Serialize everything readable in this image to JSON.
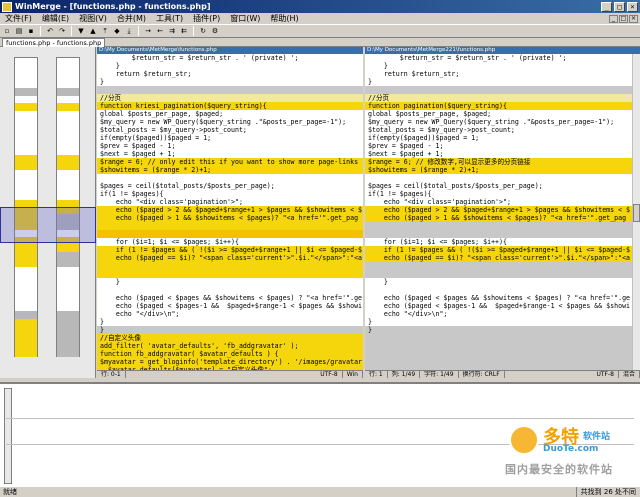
{
  "window": {
    "title": "WinMerge - [functions.php - functions.php]"
  },
  "menu": [
    "文件(F)",
    "编辑(E)",
    "视图(V)",
    "合并(M)",
    "工具(T)",
    "插件(P)",
    "窗口(W)",
    "帮助(H)"
  ],
  "doc_tab": "functions.php - functions.php",
  "left": {
    "path": "D:\\My Documents\\MetMerge\\functions.php",
    "status": [
      "行: 0-1",
      "UTF-8",
      "Win"
    ],
    "lines": [
      {
        "t": "        $return_str = $return_str . ' (private) ';",
        "c": ""
      },
      {
        "t": "    }",
        "c": ""
      },
      {
        "t": "    return $return_str;",
        "c": ""
      },
      {
        "t": "}",
        "c": ""
      },
      {
        "t": "",
        "c": "blank"
      },
      {
        "t": "//分页",
        "c": "cur"
      },
      {
        "t": "function kriesi_pagination($query_string){",
        "c": "chg"
      },
      {
        "t": "global $posts_per_page, $paged;",
        "c": ""
      },
      {
        "t": "$my_query = new WP_Query($query_string .\"&posts_per_page=-1\");",
        "c": ""
      },
      {
        "t": "$total_posts = $my_query->post_count;",
        "c": ""
      },
      {
        "t": "if(empty($paged))$paged = 1;",
        "c": ""
      },
      {
        "t": "$prev = $paged - 1;",
        "c": ""
      },
      {
        "t": "$next = $paged + 1;",
        "c": ""
      },
      {
        "t": "$range = 6; // only edit this if you want to show more page-links",
        "c": "chg"
      },
      {
        "t": "$showitems = ($range * 2)+1;",
        "c": "chg"
      },
      {
        "t": "",
        "c": ""
      },
      {
        "t": "$pages = ceil($total_posts/$posts_per_page);",
        "c": ""
      },
      {
        "t": "if(1 != $pages){",
        "c": ""
      },
      {
        "t": "    echo \"<div class='pagination'>\";",
        "c": ""
      },
      {
        "t": "    echo ($paged > 2 && $paged+$range+1 > $pages && $showitems < $",
        "c": "chg"
      },
      {
        "t": "    echo ($paged > 1 && $showitems < $pages)? \"<a href='\".get_pag",
        "c": "chg"
      },
      {
        "t": "",
        "c": "chg"
      },
      {
        "t": "",
        "c": "sel"
      },
      {
        "t": "    for ($i=1; $i <= $pages; $i++){",
        "c": ""
      },
      {
        "t": "    if (1 != $pages && ( !($i >= $paged+$range+1 || $i <= $paged-$",
        "c": "chg"
      },
      {
        "t": "    echo ($paged == $i)? \"<span class='current'>\".$i.\"</span>\":\"<a",
        "c": "chg"
      },
      {
        "t": "",
        "c": "chg"
      },
      {
        "t": "",
        "c": "chg"
      },
      {
        "t": "    }",
        "c": ""
      },
      {
        "t": "",
        "c": ""
      },
      {
        "t": "    echo ($paged < $pages && $showitems < $pages) ? \"<a href='\".ge",
        "c": ""
      },
      {
        "t": "    echo ($paged < $pages-1 &&  $paged+$range-1 < $pages && $showi",
        "c": ""
      },
      {
        "t": "    echo \"</div>\\n\";",
        "c": ""
      },
      {
        "t": "}",
        "c": ""
      },
      {
        "t": "}",
        "c": "blank"
      },
      {
        "t": "//自定义头像",
        "c": "chg"
      },
      {
        "t": "add_filter( 'avatar_defaults', 'fb_addgravatar' );",
        "c": "chg"
      },
      {
        "t": "function fb_addgravatar( $avatar_defaults ) {",
        "c": "chg"
      },
      {
        "t": "$myavatar = get_bloginfo('template_directory') . '/images/gravatar",
        "c": "chg"
      },
      {
        "t": "  $avatar_defaults[$myavatar] = \"自定义头像\";",
        "c": "chg"
      }
    ]
  },
  "right": {
    "path": "D:\\My Documents\\MetMerge221\\functions.php",
    "status": [
      "行: 1",
      "列: 1/49",
      "字符: 1/49",
      "换行符: CRLF",
      "UTF-8",
      "混合"
    ],
    "lines": [
      {
        "t": "        $return_str = $return_str . ' (private) ';",
        "c": ""
      },
      {
        "t": "    }",
        "c": ""
      },
      {
        "t": "    return $return_str;",
        "c": ""
      },
      {
        "t": "}",
        "c": ""
      },
      {
        "t": "",
        "c": "blank"
      },
      {
        "t": "//分页",
        "c": "cur"
      },
      {
        "t": "function pagination($query_string){",
        "c": "chg"
      },
      {
        "t": "global $posts_per_page, $paged;",
        "c": ""
      },
      {
        "t": "$my_query = new WP_Query($query_string .\"&posts_per_page=-1\");",
        "c": ""
      },
      {
        "t": "$total_posts = $my_query->post_count;",
        "c": ""
      },
      {
        "t": "if(empty($paged))$paged = 1;",
        "c": ""
      },
      {
        "t": "$prev = $paged - 1;",
        "c": ""
      },
      {
        "t": "$next = $paged + 1;",
        "c": ""
      },
      {
        "t": "$range = 6; // 修改数字,可以显示更多的分页链接",
        "c": "chg"
      },
      {
        "t": "$showitems = ($range * 2)+1;",
        "c": "chg"
      },
      {
        "t": "",
        "c": ""
      },
      {
        "t": "$pages = ceil($total_posts/$posts_per_page);",
        "c": ""
      },
      {
        "t": "if(1 != $pages){",
        "c": ""
      },
      {
        "t": "    echo \"<div class='pagination'>\";",
        "c": ""
      },
      {
        "t": "    echo ($paged > 2 && $paged+$range+1 > $pages && $showitems < $",
        "c": "chg"
      },
      {
        "t": "    echo ($paged > 1 && $showitems < $pages)? \"<a href='\".get_pag",
        "c": "chg"
      },
      {
        "t": "",
        "c": "blank"
      },
      {
        "t": "",
        "c": "blank"
      },
      {
        "t": "    for ($i=1; $i <= $pages; $i++){",
        "c": ""
      },
      {
        "t": "    if (1 != $pages && ( !($i >= $paged+$range+1 || $i <= $paged-$",
        "c": "chg"
      },
      {
        "t": "    echo ($paged == $i)? \"<span class='current'>\".$i.\"</span>\":\"<a",
        "c": "chg"
      },
      {
        "t": "",
        "c": "blank"
      },
      {
        "t": "",
        "c": "blank"
      },
      {
        "t": "    }",
        "c": ""
      },
      {
        "t": "",
        "c": ""
      },
      {
        "t": "    echo ($paged < $pages && $showitems < $pages) ? \"<a href='\".ge",
        "c": ""
      },
      {
        "t": "    echo ($paged < $pages-1 &&  $paged+$range-1 < $pages && $showi",
        "c": ""
      },
      {
        "t": "    echo \"</div>\\n\";",
        "c": ""
      },
      {
        "t": "}",
        "c": ""
      },
      {
        "t": "}",
        "c": "blank"
      },
      {
        "t": "",
        "c": "blank"
      },
      {
        "t": "",
        "c": "blank"
      },
      {
        "t": "",
        "c": "blank"
      },
      {
        "t": "",
        "c": "blank"
      },
      {
        "t": "",
        "c": "blank"
      }
    ]
  },
  "statusbar": {
    "left": "就绪",
    "right": "共找到 26 处不同"
  },
  "watermark": {
    "brand": "多特",
    "sub": "软件站",
    "domain": "DuoTe.com",
    "slogan": "国内最安全的软件站"
  }
}
